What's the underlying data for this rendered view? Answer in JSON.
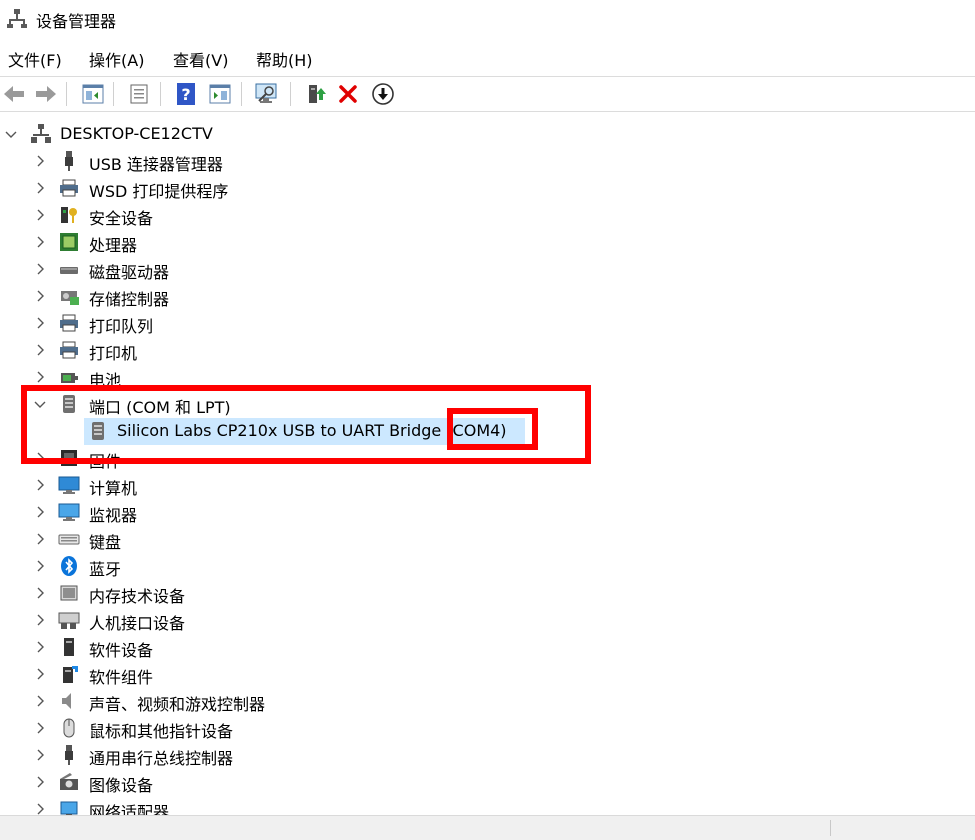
{
  "window": {
    "title": "设备管理器"
  },
  "menu": [
    "文件(F)",
    "操作(A)",
    "查看(V)",
    "帮助(H)"
  ],
  "toolbar": [
    "back-icon",
    "forward-icon",
    "properties-pane-icon",
    "scan-icon",
    "help-icon",
    "view-icon",
    "monitor-icon",
    "update-driver-icon",
    "uninstall-icon",
    "download-icon"
  ],
  "tree": {
    "root": "DESKTOP-CE12CTV",
    "items": [
      {
        "label": "USB 连接器管理器",
        "icon": "usb-connector-icon",
        "expanded": false
      },
      {
        "label": "WSD 打印提供程序",
        "icon": "printer-icon",
        "expanded": false
      },
      {
        "label": "安全设备",
        "icon": "security-device-icon",
        "expanded": false
      },
      {
        "label": "处理器",
        "icon": "processor-icon",
        "expanded": false
      },
      {
        "label": "磁盘驱动器",
        "icon": "disk-drive-icon",
        "expanded": false
      },
      {
        "label": "存储控制器",
        "icon": "storage-controller-icon",
        "expanded": false
      },
      {
        "label": "打印队列",
        "icon": "printer-icon",
        "expanded": false
      },
      {
        "label": "打印机",
        "icon": "printer-icon",
        "expanded": false
      },
      {
        "label": "电池",
        "icon": "battery-icon",
        "expanded": false
      },
      {
        "label": "端口 (COM 和 LPT)",
        "icon": "port-icon",
        "expanded": true,
        "children": [
          {
            "label": "Silicon Labs CP210x USB to UART Bridge (COM4)",
            "icon": "port-icon",
            "selected": true
          }
        ]
      },
      {
        "label": "固件",
        "icon": "firmware-icon",
        "expanded": false
      },
      {
        "label": "计算机",
        "icon": "computer-icon",
        "expanded": false
      },
      {
        "label": "监视器",
        "icon": "monitor-icon",
        "expanded": false
      },
      {
        "label": "键盘",
        "icon": "keyboard-icon",
        "expanded": false
      },
      {
        "label": "蓝牙",
        "icon": "bluetooth-icon",
        "expanded": false
      },
      {
        "label": "内存技术设备",
        "icon": "memory-device-icon",
        "expanded": false
      },
      {
        "label": "人机接口设备",
        "icon": "hid-icon",
        "expanded": false
      },
      {
        "label": "软件设备",
        "icon": "software-device-icon",
        "expanded": false
      },
      {
        "label": "软件组件",
        "icon": "software-component-icon",
        "expanded": false
      },
      {
        "label": "声音、视频和游戏控制器",
        "icon": "sound-icon",
        "expanded": false
      },
      {
        "label": "鼠标和其他指针设备",
        "icon": "mouse-icon",
        "expanded": false
      },
      {
        "label": "通用串行总线控制器",
        "icon": "usb-controller-icon",
        "expanded": false
      },
      {
        "label": "图像设备",
        "icon": "imaging-device-icon",
        "expanded": false
      },
      {
        "label": "网络适配器",
        "icon": "network-adapter-icon",
        "expanded": false
      }
    ]
  },
  "colors": {
    "selection": "#cce8ff",
    "highlight": "#ff0000"
  }
}
